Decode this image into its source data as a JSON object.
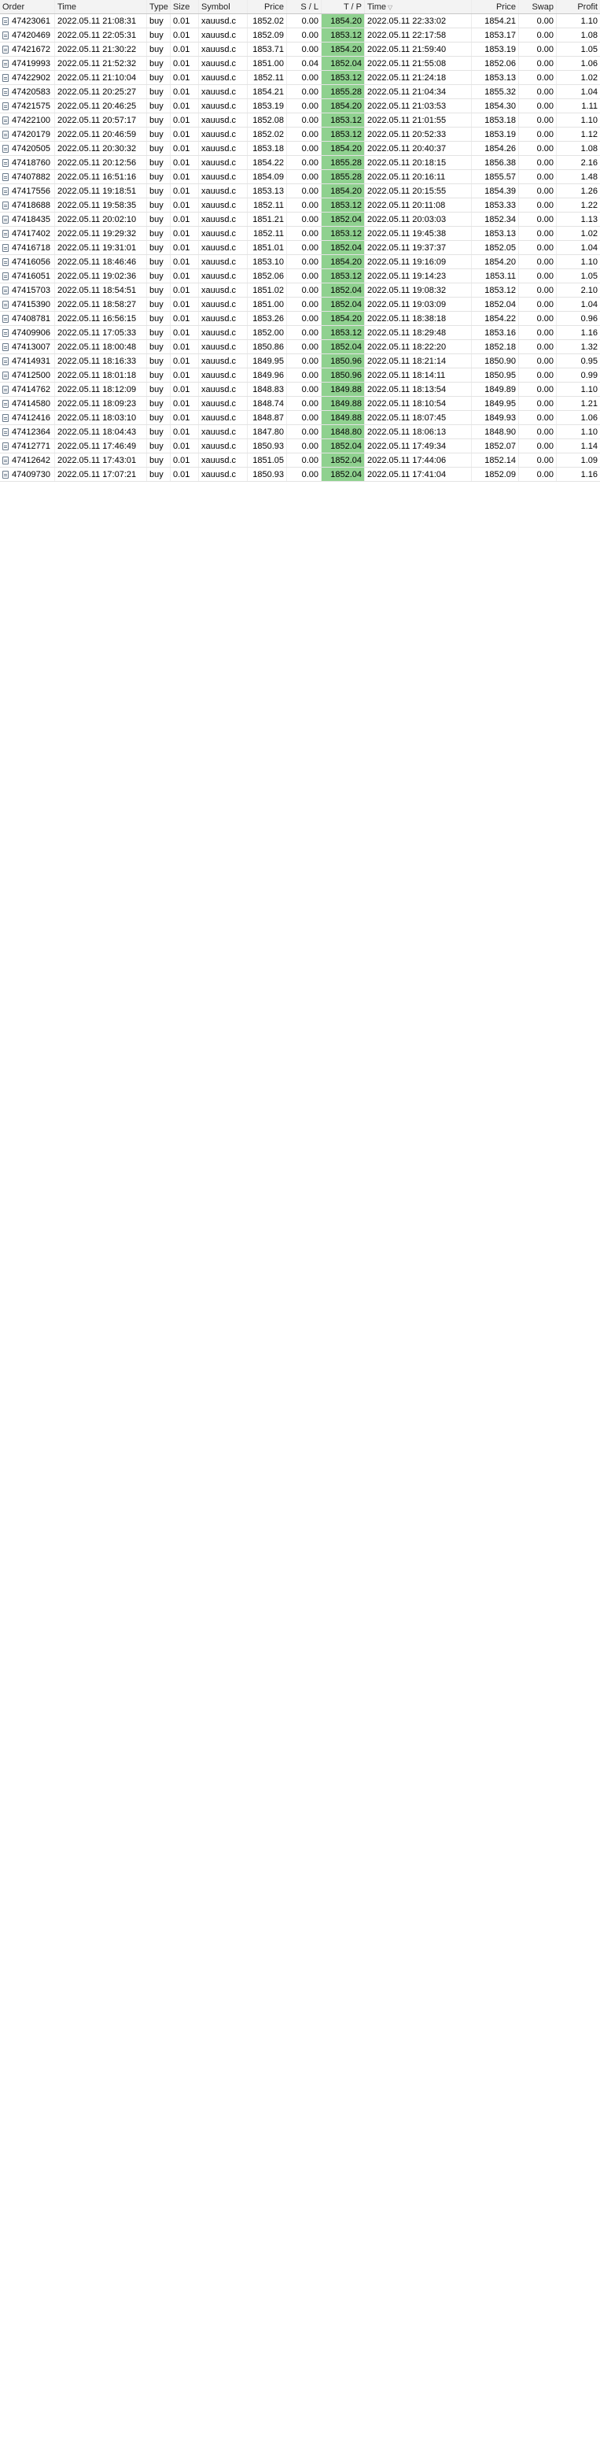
{
  "header": {
    "order": "Order",
    "open_time": "Time",
    "type": "Type",
    "size": "Size",
    "symbol": "Symbol",
    "price": "Price",
    "sl": "S / L",
    "tp": "T / P",
    "close_time": "Time",
    "close_price": "Price",
    "swap": "Swap",
    "profit": "Profit",
    "sort_arrow": "▽"
  },
  "colors": {
    "tp_highlight": "#8fd18f",
    "header_bg": "#f3f3f3",
    "grid_line": "#e3e3e3"
  },
  "rows": [
    [
      "47423061",
      "2022.05.11 21:08:31",
      "buy",
      "0.01",
      "xauusd.c",
      "1852.02",
      "0.00",
      "1854.20",
      "2022.05.11 22:33:02",
      "1854.21",
      "0.00",
      "1.10"
    ],
    [
      "47420469",
      "2022.05.11 22:05:31",
      "buy",
      "0.01",
      "xauusd.c",
      "1852.09",
      "0.00",
      "1853.12",
      "2022.05.11 22:17:58",
      "1853.17",
      "0.00",
      "1.08"
    ],
    [
      "47421672",
      "2022.05.11 21:30:22",
      "buy",
      "0.01",
      "xauusd.c",
      "1853.71",
      "0.00",
      "1854.20",
      "2022.05.11 21:59:40",
      "1853.19",
      "0.00",
      "1.05"
    ],
    [
      "47419993",
      "2022.05.11 21:52:32",
      "buy",
      "0.01",
      "xauusd.c",
      "1851.00",
      "0.04",
      "1852.04",
      "2022.05.11 21:55:08",
      "1852.06",
      "0.00",
      "1.06"
    ],
    [
      "47422902",
      "2022.05.11 21:10:04",
      "buy",
      "0.01",
      "xauusd.c",
      "1852.11",
      "0.00",
      "1853.12",
      "2022.05.11 21:24:18",
      "1853.13",
      "0.00",
      "1.02"
    ],
    [
      "47420583",
      "2022.05.11 20:25:27",
      "buy",
      "0.01",
      "xauusd.c",
      "1854.21",
      "0.00",
      "1855.28",
      "2022.05.11 21:04:34",
      "1855.32",
      "0.00",
      "1.04"
    ],
    [
      "47421575",
      "2022.05.11 20:46:25",
      "buy",
      "0.01",
      "xauusd.c",
      "1853.19",
      "0.00",
      "1854.20",
      "2022.05.11 21:03:53",
      "1854.30",
      "0.00",
      "1.11"
    ],
    [
      "47422100",
      "2022.05.11 20:57:17",
      "buy",
      "0.01",
      "xauusd.c",
      "1852.08",
      "0.00",
      "1853.12",
      "2022.05.11 21:01:55",
      "1853.18",
      "0.00",
      "1.10"
    ],
    [
      "47420179",
      "2022.05.11 20:46:59",
      "buy",
      "0.01",
      "xauusd.c",
      "1852.02",
      "0.00",
      "1853.12",
      "2022.05.11 20:52:33",
      "1853.19",
      "0.00",
      "1.12"
    ],
    [
      "47420505",
      "2022.05.11 20:30:32",
      "buy",
      "0.01",
      "xauusd.c",
      "1853.18",
      "0.00",
      "1854.20",
      "2022.05.11 20:40:37",
      "1854.26",
      "0.00",
      "1.08"
    ],
    [
      "47418760",
      "2022.05.11 20:12:56",
      "buy",
      "0.01",
      "xauusd.c",
      "1854.22",
      "0.00",
      "1855.28",
      "2022.05.11 20:18:15",
      "1856.38",
      "0.00",
      "2.16"
    ],
    [
      "47407882",
      "2022.05.11 16:51:16",
      "buy",
      "0.01",
      "xauusd.c",
      "1854.09",
      "0.00",
      "1855.28",
      "2022.05.11 20:16:11",
      "1855.57",
      "0.00",
      "1.48"
    ],
    [
      "47417556",
      "2022.05.11 19:18:51",
      "buy",
      "0.01",
      "xauusd.c",
      "1853.13",
      "0.00",
      "1854.20",
      "2022.05.11 20:15:55",
      "1854.39",
      "0.00",
      "1.26"
    ],
    [
      "47418688",
      "2022.05.11 19:58:35",
      "buy",
      "0.01",
      "xauusd.c",
      "1852.11",
      "0.00",
      "1853.12",
      "2022.05.11 20:11:08",
      "1853.33",
      "0.00",
      "1.22"
    ],
    [
      "47418435",
      "2022.05.11 20:02:10",
      "buy",
      "0.01",
      "xauusd.c",
      "1851.21",
      "0.00",
      "1852.04",
      "2022.05.11 20:03:03",
      "1852.34",
      "0.00",
      "1.13"
    ],
    [
      "47417402",
      "2022.05.11 19:29:32",
      "buy",
      "0.01",
      "xauusd.c",
      "1852.11",
      "0.00",
      "1853.12",
      "2022.05.11 19:45:38",
      "1853.13",
      "0.00",
      "1.02"
    ],
    [
      "47416718",
      "2022.05.11 19:31:01",
      "buy",
      "0.01",
      "xauusd.c",
      "1851.01",
      "0.00",
      "1852.04",
      "2022.05.11 19:37:37",
      "1852.05",
      "0.00",
      "1.04"
    ],
    [
      "47416056",
      "2022.05.11 18:46:46",
      "buy",
      "0.01",
      "xauusd.c",
      "1853.10",
      "0.00",
      "1854.20",
      "2022.05.11 19:16:09",
      "1854.20",
      "0.00",
      "1.10"
    ],
    [
      "47416051",
      "2022.05.11 19:02:36",
      "buy",
      "0.01",
      "xauusd.c",
      "1852.06",
      "0.00",
      "1853.12",
      "2022.05.11 19:14:23",
      "1853.11",
      "0.00",
      "1.05"
    ],
    [
      "47415703",
      "2022.05.11 18:54:51",
      "buy",
      "0.01",
      "xauusd.c",
      "1851.02",
      "0.00",
      "1852.04",
      "2022.05.11 19:08:32",
      "1853.12",
      "0.00",
      "2.10"
    ],
    [
      "47415390",
      "2022.05.11 18:58:27",
      "buy",
      "0.01",
      "xauusd.c",
      "1851.00",
      "0.00",
      "1852.04",
      "2022.05.11 19:03:09",
      "1852.04",
      "0.00",
      "1.04"
    ],
    [
      "47408781",
      "2022.05.11 16:56:15",
      "buy",
      "0.01",
      "xauusd.c",
      "1853.26",
      "0.00",
      "1854.20",
      "2022.05.11 18:38:18",
      "1854.22",
      "0.00",
      "0.96"
    ],
    [
      "47409906",
      "2022.05.11 17:05:33",
      "buy",
      "0.01",
      "xauusd.c",
      "1852.00",
      "0.00",
      "1853.12",
      "2022.05.11 18:29:48",
      "1853.16",
      "0.00",
      "1.16"
    ],
    [
      "47413007",
      "2022.05.11 18:00:48",
      "buy",
      "0.01",
      "xauusd.c",
      "1850.86",
      "0.00",
      "1852.04",
      "2022.05.11 18:22:20",
      "1852.18",
      "0.00",
      "1.32"
    ],
    [
      "47414931",
      "2022.05.11 18:16:33",
      "buy",
      "0.01",
      "xauusd.c",
      "1849.95",
      "0.00",
      "1850.96",
      "2022.05.11 18:21:14",
      "1850.90",
      "0.00",
      "0.95"
    ],
    [
      "47412500",
      "2022.05.11 18:01:18",
      "buy",
      "0.01",
      "xauusd.c",
      "1849.96",
      "0.00",
      "1850.96",
      "2022.05.11 18:14:11",
      "1850.95",
      "0.00",
      "0.99"
    ],
    [
      "47414762",
      "2022.05.11 18:12:09",
      "buy",
      "0.01",
      "xauusd.c",
      "1848.83",
      "0.00",
      "1849.88",
      "2022.05.11 18:13:54",
      "1849.89",
      "0.00",
      "1.10"
    ],
    [
      "47414580",
      "2022.05.11 18:09:23",
      "buy",
      "0.01",
      "xauusd.c",
      "1848.74",
      "0.00",
      "1849.88",
      "2022.05.11 18:10:54",
      "1849.95",
      "0.00",
      "1.21"
    ],
    [
      "47412416",
      "2022.05.11 18:03:10",
      "buy",
      "0.01",
      "xauusd.c",
      "1848.87",
      "0.00",
      "1849.88",
      "2022.05.11 18:07:45",
      "1849.93",
      "0.00",
      "1.06"
    ],
    [
      "47412364",
      "2022.05.11 18:04:43",
      "buy",
      "0.01",
      "xauusd.c",
      "1847.80",
      "0.00",
      "1848.80",
      "2022.05.11 18:06:13",
      "1848.90",
      "0.00",
      "1.10"
    ],
    [
      "47412771",
      "2022.05.11 17:46:49",
      "buy",
      "0.01",
      "xauusd.c",
      "1850.93",
      "0.00",
      "1852.04",
      "2022.05.11 17:49:34",
      "1852.07",
      "0.00",
      "1.14"
    ],
    [
      "47412642",
      "2022.05.11 17:43:01",
      "buy",
      "0.01",
      "xauusd.c",
      "1851.05",
      "0.00",
      "1852.04",
      "2022.05.11 17:44:06",
      "1852.14",
      "0.00",
      "1.09"
    ],
    [
      "47409730",
      "2022.05.11 17:07:21",
      "buy",
      "0.01",
      "xauusd.c",
      "1850.93",
      "0.00",
      "1852.04",
      "2022.05.11 17:41:04",
      "1852.09",
      "0.00",
      "1.16"
    ]
  ]
}
